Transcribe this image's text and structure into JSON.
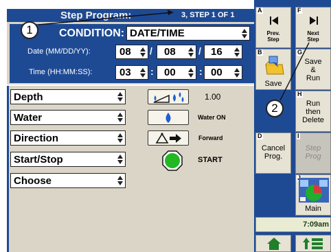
{
  "header": {
    "title": "Step Program:",
    "step": "3, STEP  1  OF  1"
  },
  "condition": {
    "label": "CONDITION:",
    "value": "DATE/TIME"
  },
  "date": {
    "label": "Date (MM/DD/YY):",
    "month": "08",
    "day": "08",
    "year": "16",
    "sep": "/"
  },
  "time": {
    "label": "Time (HH:MM:SS):",
    "hour": "03",
    "minute": "00",
    "second": "00",
    "sep": ":"
  },
  "commands": [
    {
      "label": "Depth",
      "icon": "depth-drops-icon",
      "value": "1.00"
    },
    {
      "label": "Water",
      "icon": "water-drop-icon",
      "value": "Water ON"
    },
    {
      "label": "Direction",
      "icon": "direction-arrow-icon",
      "value": "Forward"
    },
    {
      "label": "Start/Stop",
      "icon": "start-circle-icon",
      "value": "START"
    },
    {
      "label": "Choose"
    }
  ],
  "sidebar": {
    "prev": {
      "letter": "A",
      "label1": "Prev.",
      "label2": "Step"
    },
    "next": {
      "letter": "F",
      "label1": "Next",
      "label2": "Step"
    },
    "save": {
      "letter": "B",
      "label": "Save"
    },
    "save_run": {
      "letter": "G",
      "label1": "Save",
      "label2": "&",
      "label3": "Run"
    },
    "run_delete": {
      "letter": "H",
      "label1": "Run",
      "label2": "then",
      "label3": "Delete"
    },
    "cancel": {
      "letter": "D",
      "label1": "Cancel",
      "label2": "Prog."
    },
    "step_prog": {
      "letter": "I",
      "label1": "Step",
      "label2": "Prog"
    },
    "main": {
      "letter": "J",
      "label": "Main"
    },
    "clock": "7:09am"
  },
  "callouts": [
    "1",
    "2"
  ],
  "colors": {
    "panel": "#1e4a94",
    "background": "#dad5c6",
    "start": "#22b822"
  }
}
